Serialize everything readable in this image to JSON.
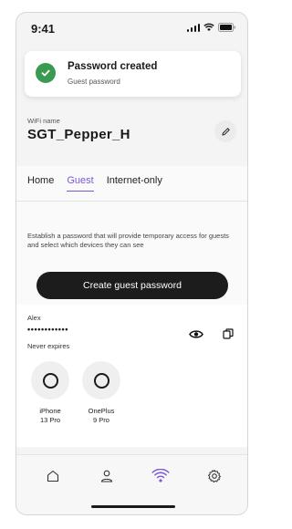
{
  "status_bar": {
    "time": "9:41"
  },
  "toast": {
    "title": "Password created",
    "subtitle": "Guest password"
  },
  "network": {
    "label": "WiFi name",
    "name": "SGT_Pepper_H"
  },
  "tabs": [
    {
      "label": "Home",
      "active": false
    },
    {
      "label": "Guest",
      "active": true
    },
    {
      "label": "Internet-only",
      "active": false
    }
  ],
  "guest": {
    "description": "Establish a password that will provide temporary access for guests and select which devices they can see",
    "create_button": "Create guest password"
  },
  "credential": {
    "user": "Alex",
    "password_masked": "••••••••••••",
    "expiry": "Never expires"
  },
  "devices": [
    {
      "line1": "iPhone",
      "line2": "13 Pro"
    },
    {
      "line1": "OnePlus",
      "line2": "9 Pro"
    }
  ],
  "nav": {
    "items": [
      {
        "icon": "home-icon",
        "active": false
      },
      {
        "icon": "person-icon",
        "active": false
      },
      {
        "icon": "wifi-icon",
        "active": true
      },
      {
        "icon": "gear-icon",
        "active": false
      }
    ]
  },
  "colors": {
    "accent": "#7b57d6",
    "success": "#3a9a52",
    "button": "#1c1c1c"
  }
}
